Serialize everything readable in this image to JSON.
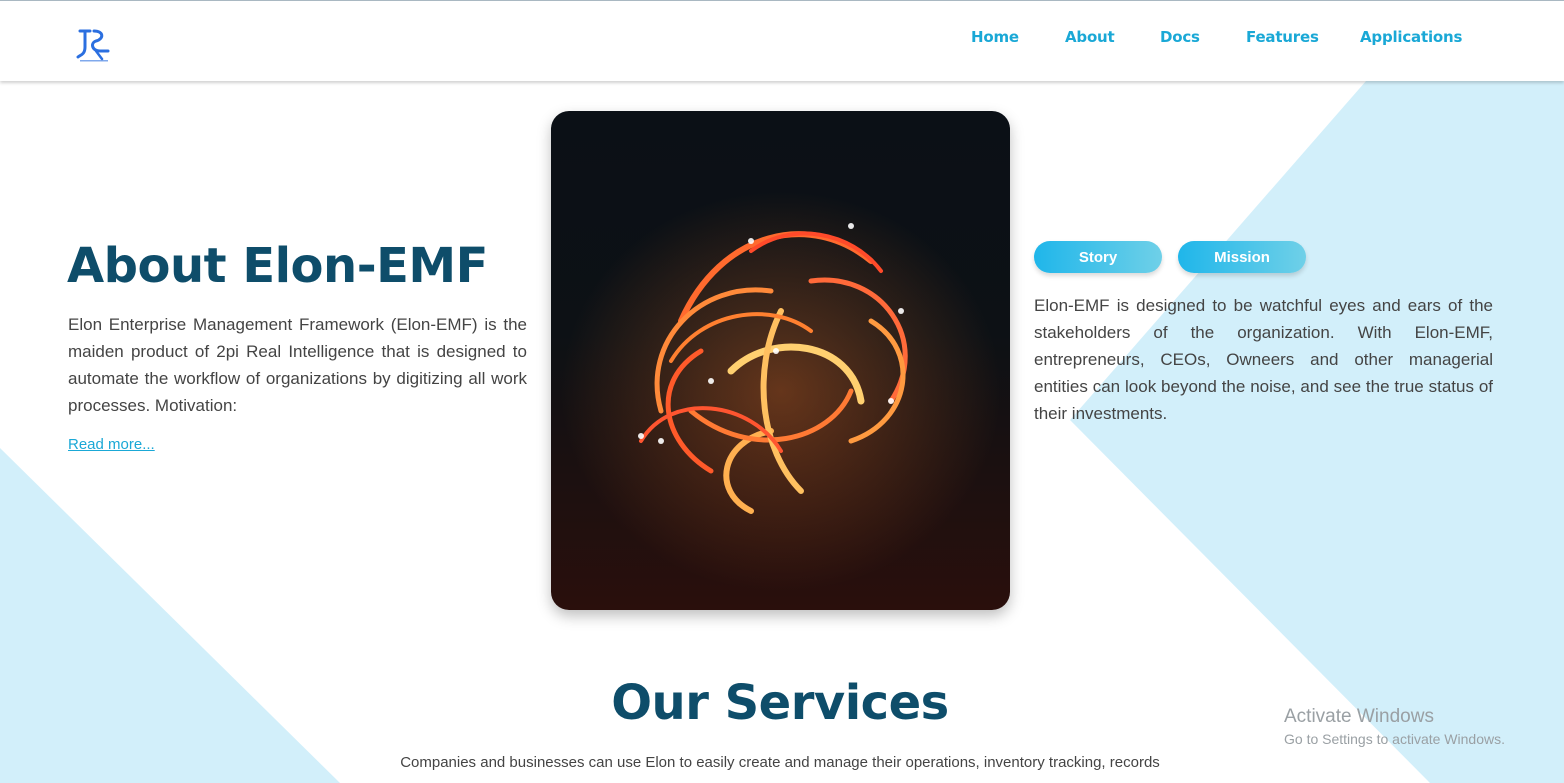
{
  "header": {
    "logo_name": "2pi-logo",
    "nav": [
      {
        "label": "Home"
      },
      {
        "label": "About"
      },
      {
        "label": "Docs"
      },
      {
        "label": "Features"
      },
      {
        "label": "Applications"
      }
    ]
  },
  "about": {
    "title": "About Elon-EMF",
    "text": "Elon Enterprise Management Framework (Elon-EMF) is the maiden product of 2pi Real Intelligence that is designed to automate the workflow of organizations by digitizing all work processes. Motivation:",
    "read_more": "Read more..."
  },
  "tabs": {
    "story": "Story",
    "mission": "Mission"
  },
  "mission_text": "Elon-EMF is designed to be watchful eyes and ears of the stakeholders of the organization. With Elon-EMF, entrepreneurs, CEOs, Owneers and other managerial entities can look beyond the noise, and see the true status of their investments.",
  "services": {
    "title": "Our Services",
    "text": "Companies and businesses can use Elon to easily create and manage their operations, inventory tracking, records"
  },
  "watermark": {
    "line1": "Activate Windows",
    "line2": "Go to Settings to activate Windows."
  },
  "colors": {
    "accent": "#1aa8d6",
    "heading": "#0e4d6a",
    "background_shape": "#d2effa"
  }
}
